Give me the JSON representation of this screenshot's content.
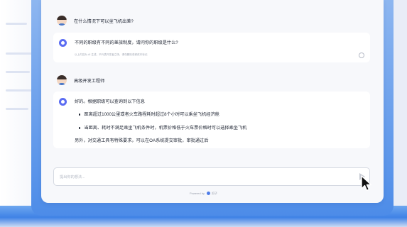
{
  "colors": {
    "accent": "#5b6cf2",
    "frame_blue": "#4d8ce8",
    "panel": "#f7f8fb",
    "card": "#ffffff"
  },
  "messages": {
    "user_1": {
      "text": "在什么情况下可以坐飞机出差?",
      "icon": "user-avatar"
    },
    "bot_1": {
      "text": "不同的职级有不同的差旅制度，请问你的职级是什么?",
      "note": "以上内容为 AI 生成，不代表开发者立场，请勿删除或修改本标记",
      "icon": "bot-icon"
    },
    "user_2": {
      "text": "高级开发工程师",
      "icon": "user-avatar"
    },
    "bot_2": {
      "intro": "好的。根据职级可以查询到以下信息",
      "bullets": [
        "距离超过1000公里或者火车路程耗时超过8个小时可以乘坐飞机经济舱",
        "当距离、耗时不满足乘坐飞机条件时，机票价格低于火车票价格时可以选择乘坐飞机"
      ],
      "outro": "另外，对交通工具有特殊要求，可以在OA系统提交审批，审批通过后",
      "icon": "bot-icon"
    }
  },
  "input": {
    "placeholder": "提出你的想法...",
    "value": ""
  },
  "footer": {
    "powered_by": "Powered by",
    "brand": "扣子"
  }
}
